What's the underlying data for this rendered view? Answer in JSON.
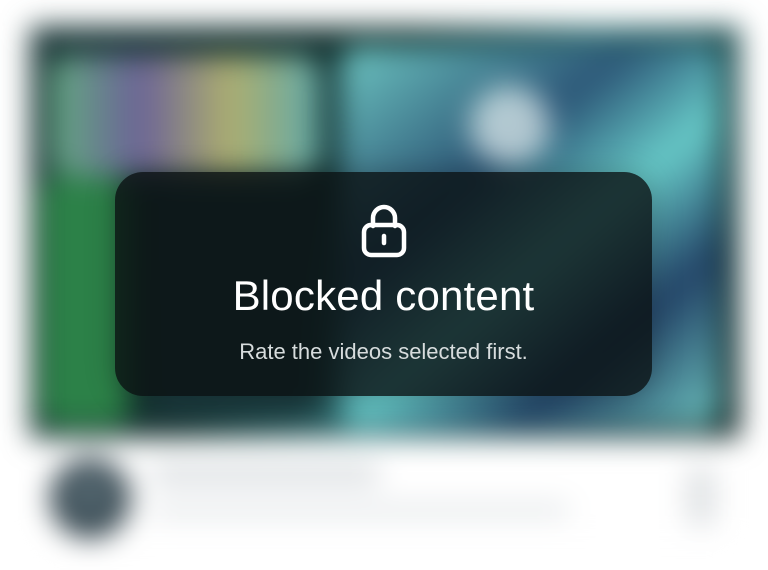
{
  "overlay": {
    "icon": "lock-icon",
    "title": "Blocked content",
    "subtitle": "Rate the videos selected first."
  },
  "colors": {
    "overlay_bg": "#0a1012",
    "text": "#ffffff",
    "subtext": "#d7dcdd"
  }
}
